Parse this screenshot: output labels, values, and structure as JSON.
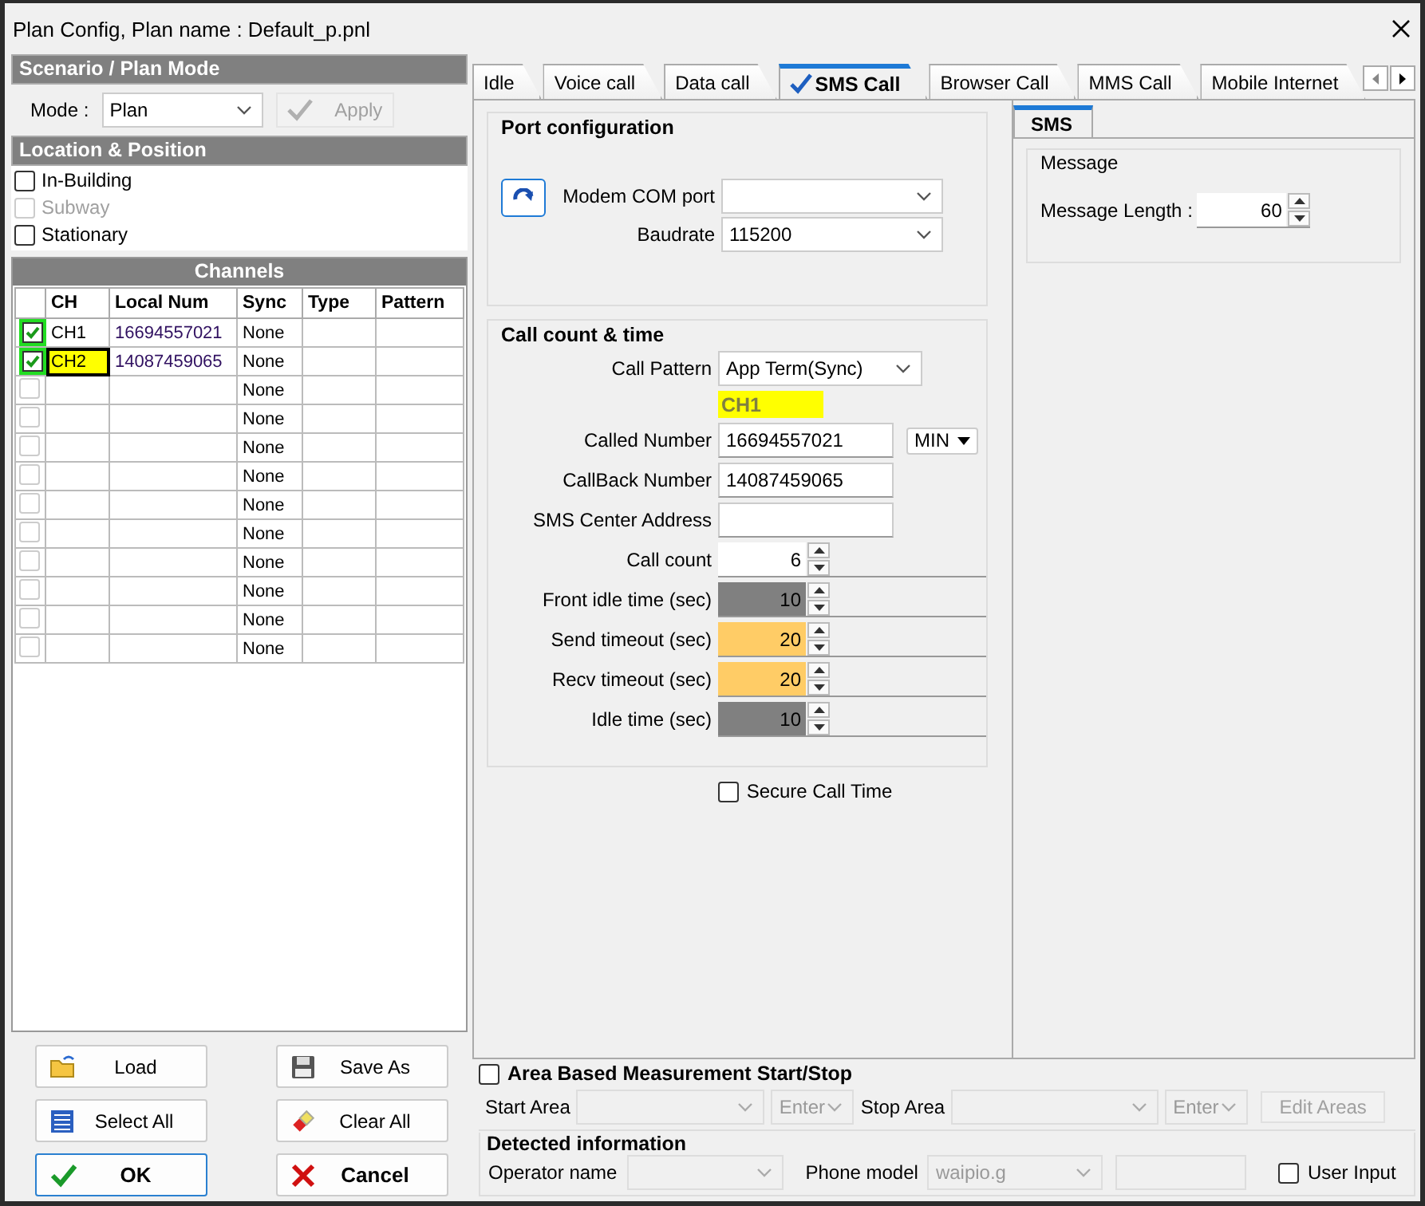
{
  "window": {
    "title": "Plan Config, Plan name : Default_p.pnl"
  },
  "scenario": {
    "header": "Scenario / Plan Mode",
    "mode_label": "Mode :",
    "mode_value": "Plan",
    "apply": {
      "label": "Apply",
      "disabled": true
    }
  },
  "location": {
    "header": "Location & Position",
    "options": [
      {
        "label": "In-Building",
        "checked": false,
        "disabled": false
      },
      {
        "label": "Subway",
        "checked": false,
        "disabled": true
      },
      {
        "label": "Stationary",
        "checked": false,
        "disabled": false
      }
    ]
  },
  "channels": {
    "title": "Channels",
    "columns": [
      "CH",
      "Local Num",
      "Sync",
      "Type",
      "Pattern"
    ],
    "rows": [
      {
        "checked": true,
        "disabled": false,
        "selected": false,
        "ch": "CH1",
        "local_num": "16694557021",
        "sync": "None"
      },
      {
        "checked": true,
        "disabled": false,
        "selected": true,
        "ch": "CH2",
        "local_num": "14087459065",
        "sync": "None"
      },
      {
        "checked": false,
        "disabled": true,
        "selected": false,
        "sync": "None"
      },
      {
        "checked": false,
        "disabled": true,
        "selected": false,
        "sync": "None"
      },
      {
        "checked": false,
        "disabled": true,
        "selected": false,
        "sync": "None"
      },
      {
        "checked": false,
        "disabled": true,
        "selected": false,
        "sync": "None"
      },
      {
        "checked": false,
        "disabled": true,
        "selected": false,
        "sync": "None"
      },
      {
        "checked": false,
        "disabled": true,
        "selected": false,
        "sync": "None"
      },
      {
        "checked": false,
        "disabled": true,
        "selected": false,
        "sync": "None"
      },
      {
        "checked": false,
        "disabled": true,
        "selected": false,
        "sync": "None"
      },
      {
        "checked": false,
        "disabled": true,
        "selected": false,
        "sync": "None"
      },
      {
        "checked": false,
        "disabled": true,
        "selected": false,
        "sync": "None"
      }
    ]
  },
  "buttons": [
    {
      "kind": "load",
      "label": "Load"
    },
    {
      "kind": "save",
      "label": "Save As"
    },
    {
      "kind": "select",
      "label": "Select All"
    },
    {
      "kind": "clear",
      "label": "Clear All"
    },
    {
      "kind": "ok",
      "label": "OK"
    },
    {
      "kind": "cancel",
      "label": "Cancel"
    }
  ],
  "tabs": [
    {
      "label": "Idle",
      "selected": false
    },
    {
      "label": "Voice call",
      "selected": false
    },
    {
      "label": "Data call",
      "selected": false
    },
    {
      "label": "SMS Call",
      "selected": true
    },
    {
      "label": "Browser Call",
      "selected": false
    },
    {
      "label": "MMS Call",
      "selected": false
    },
    {
      "label": "Mobile Internet",
      "selected": false
    }
  ],
  "port_configuration": {
    "title": "Port configuration",
    "modem_com_port_label": "Modem COM port",
    "baudrate_label": "Baudrate",
    "baudrate": "115200"
  },
  "call_count_time": {
    "title": "Call count & time",
    "call_pattern_label": "Call Pattern",
    "call_pattern": "App Term(Sync)",
    "channel_tag": "CH1",
    "called_number_label": "Called Number",
    "called_number": "16694557021",
    "number_type": "MIN",
    "callback_number_label": "CallBack Number",
    "callback_number": "14087459065",
    "sms_center_label": "SMS Center Address",
    "spinners": [
      {
        "label": "Call count",
        "value": "6",
        "color": "#ffffff"
      },
      {
        "label": "Front idle time (sec)",
        "value": "10",
        "color": "#808080"
      },
      {
        "label": "Send timeout (sec)",
        "value": "20",
        "color": "#ffcc66"
      },
      {
        "label": "Recv timeout (sec)",
        "value": "20",
        "color": "#ffcc66"
      },
      {
        "label": "Idle time (sec)",
        "value": "10",
        "color": "#808080"
      }
    ]
  },
  "secure_call_time": {
    "label": "Secure Call Time",
    "checked": false
  },
  "sms_panel": {
    "tab": {
      "label": "SMS",
      "selected": true
    },
    "group": "Message",
    "message_length_label": "Message Length :",
    "message_length": "60"
  },
  "area_measurement": {
    "label": "Area Based Measurement Start/Stop",
    "checked": false,
    "start_area_label": "Start Area",
    "start_enter": "Enter",
    "stop_area_label": "Stop Area",
    "stop_enter": "Enter",
    "edit_areas": {
      "label": "Edit Areas",
      "disabled": true
    }
  },
  "detected_information": {
    "title": "Detected information",
    "operator_name_label": "Operator name",
    "phone_model_label": "Phone model",
    "phone_model": "waipio.g",
    "user_input": {
      "label": "User Input",
      "checked": false
    }
  }
}
